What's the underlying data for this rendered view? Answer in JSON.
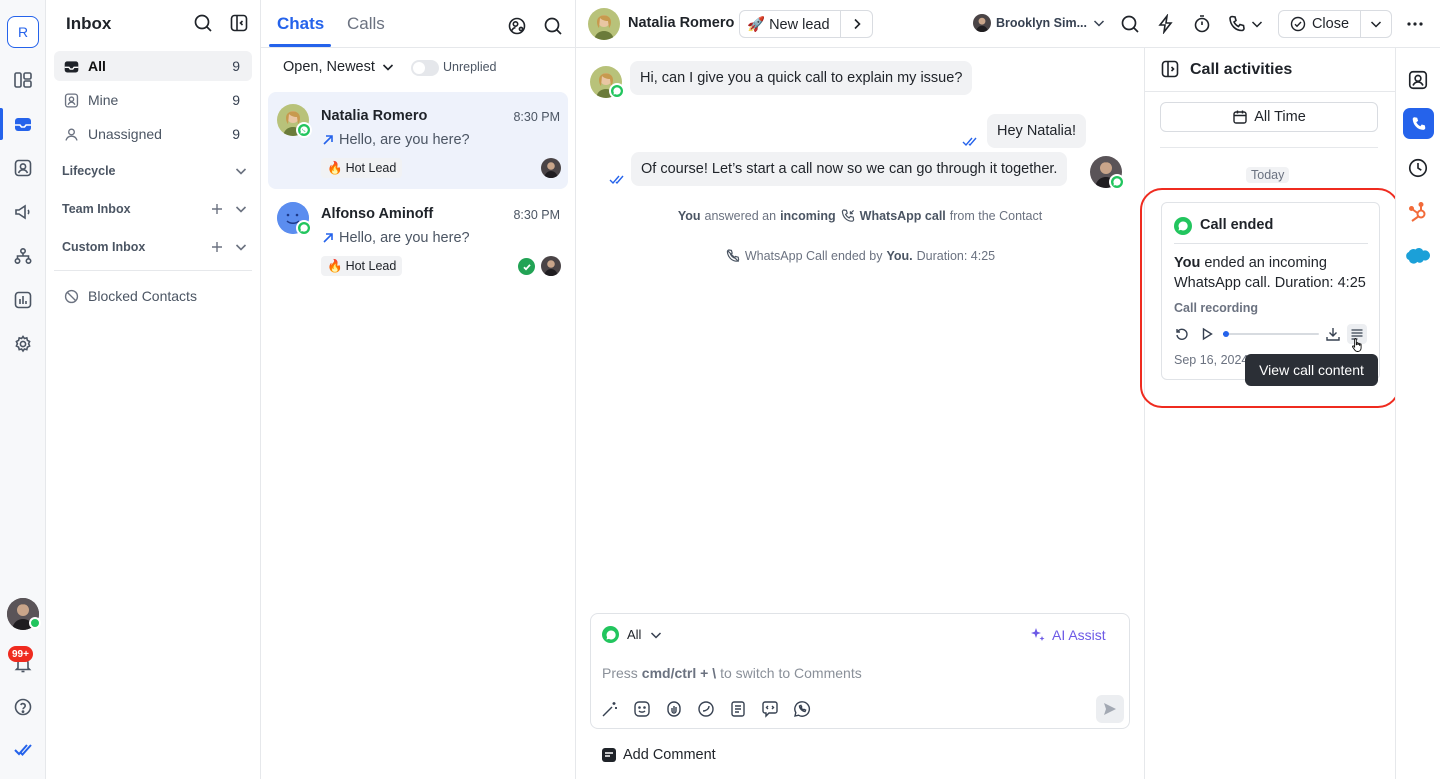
{
  "workspace": {
    "initial": "R"
  },
  "rail": {
    "notification_badge": "99+"
  },
  "inbox": {
    "title": "Inbox",
    "items": [
      {
        "label": "All",
        "count": "9"
      },
      {
        "label": "Mine",
        "count": "9"
      },
      {
        "label": "Unassigned",
        "count": "9"
      }
    ],
    "sections": {
      "lifecycle": "Lifecycle",
      "team": "Team Inbox",
      "custom": "Custom Inbox"
    },
    "blocked": "Blocked Contacts"
  },
  "chats": {
    "tabs": [
      "Chats",
      "Calls"
    ],
    "filter": "Open, Newest",
    "unreplied": "Unreplied",
    "list": [
      {
        "name": "Natalia Romero",
        "time": "8:30 PM",
        "preview": "Hello, are you here?",
        "tag": "Hot Lead"
      },
      {
        "name": "Alfonso Aminoff",
        "time": "8:30 PM",
        "preview": "Hello, are you here?",
        "tag": "Hot Lead"
      }
    ]
  },
  "header": {
    "contact_name": "Natalia Romero",
    "stage": "🚀 New lead",
    "assignee": "Brooklyn Sim...",
    "close_label": "Close"
  },
  "messages": {
    "m1": "Hi, can I give you a quick call to explain my issue?",
    "m2": "Hey Natalia!",
    "m3": "Of course! Let’s start a call now so we can go through it together.",
    "sys1": {
      "you": "You",
      "answered": "answered an",
      "incoming": "incoming",
      "wa_call": "WhatsApp call",
      "from": "from the Contact"
    },
    "sys2": {
      "prefix": "WhatsApp Call ended by",
      "you": "You.",
      "duration": "Duration: 4:25"
    }
  },
  "composer": {
    "channel": "All",
    "ai_assist": "AI Assist",
    "hint_prefix": "Press",
    "hint_keys": "cmd/ctrl + \\",
    "hint_suffix": "to switch to Comments",
    "add_comment": "Add Comment"
  },
  "call_panel": {
    "title": "Call activities",
    "filter": "All Time",
    "day": "Today",
    "card": {
      "title": "Call ended",
      "you": "You",
      "body": "ended an incoming WhatsApp call. Duration: 4:25",
      "recording_label": "Call recording",
      "recording_progress": 0.02,
      "date": "Sep 16, 2024",
      "tooltip": "View call content"
    }
  },
  "colors": {
    "accent": "#2563eb",
    "whatsapp": "#22c55e",
    "highlight": "#ef2b1f"
  }
}
